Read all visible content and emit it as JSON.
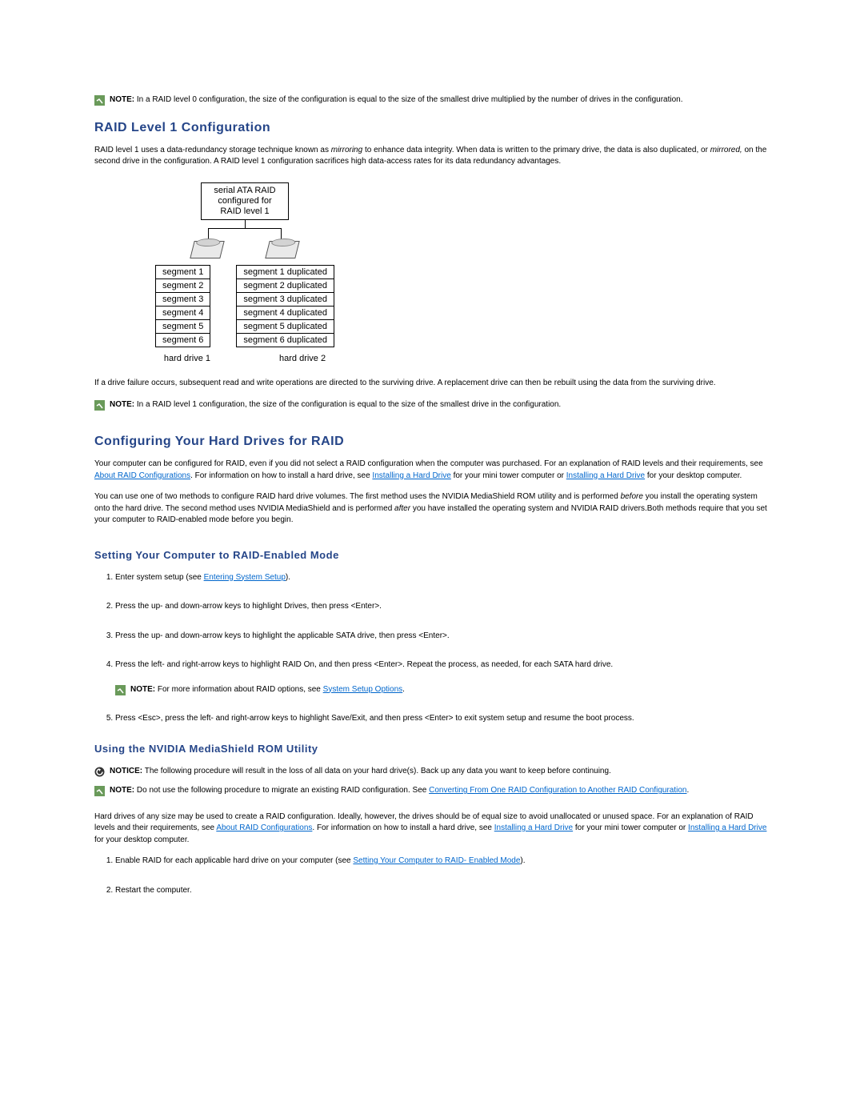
{
  "top_note": {
    "label": "NOTE:",
    "text": " In a RAID level 0 configuration, the size of the configuration is equal to the size of the smallest drive multiplied by the number of drives in the configuration."
  },
  "raid1": {
    "heading": "RAID Level 1 Configuration",
    "paragraph_before_italic1": "RAID level 1 uses a data-redundancy storage technique known as ",
    "italic1": "mirroring",
    "paragraph_mid": " to enhance data integrity. When data is written to the primary drive, the data is also duplicated, or ",
    "italic2": "mirrored,",
    "paragraph_after": " on the second drive in the configuration. A RAID level 1 configuration sacrifices high data-access rates for its data redundancy advantages.",
    "diagram": {
      "title_line1": "serial ATA RAID",
      "title_line2": "configured for",
      "title_line3": "RAID level 1",
      "left_segments": [
        "segment 1",
        "segment 2",
        "segment 3",
        "segment 4",
        "segment 5",
        "segment 6"
      ],
      "right_segments": [
        "segment 1 duplicated",
        "segment 2 duplicated",
        "segment 3 duplicated",
        "segment 4 duplicated",
        "segment 5 duplicated",
        "segment 6 duplicated"
      ],
      "foot_left": "hard drive 1",
      "foot_right": "hard drive 2"
    },
    "post_diagram": "If a drive failure occurs, subsequent read and write operations are directed to the surviving drive. A replacement drive can then be rebuilt using the data from the surviving drive.",
    "note_label": "NOTE:",
    "note_text": " In a RAID level 1 configuration, the size of the configuration is equal to the size of the smallest drive in the configuration."
  },
  "configuring": {
    "heading": "Configuring Your Hard Drives for RAID",
    "para": {
      "t1": "Your computer can be configured for RAID, even if you did not select a RAID configuration when the computer was purchased. For an explanation of RAID levels and their requirements, see ",
      "link1": "About RAID Configurations",
      "t2": ". For information on how to install a hard drive, see ",
      "link2": "Installing a Hard Drive",
      "t3": " for your mini tower computer or ",
      "link3": "Installing a Hard Drive",
      "t4": " for your desktop computer."
    },
    "para2": {
      "t1": "You can use one of two methods to configure RAID hard drive volumes. The first method uses the NVIDIA MediaShield ROM utility and is performed ",
      "i1": "before",
      "t2": " you install the operating system onto the hard drive. The second method uses NVIDIA MediaShield and is performed ",
      "i2": "after",
      "t3": " you have installed the operating system and NVIDIA RAID drivers.Both methods require that you set your computer to RAID-enabled mode before you begin."
    }
  },
  "setting": {
    "heading": "Setting Your Computer to RAID-Enabled Mode",
    "step1_t1": "Enter system setup (see ",
    "step1_link": "Entering System Setup",
    "step1_t2": ").",
    "step2": "Press the up- and down-arrow keys to highlight Drives, then press <Enter>.",
    "step3": "Press the up- and down-arrow keys to highlight the applicable SATA drive, then press <Enter>.",
    "step4": "Press the left- and right-arrow keys to highlight RAID On, and then press <Enter>. Repeat the process, as needed, for each SATA hard drive.",
    "step4_note_label": "NOTE:",
    "step4_note_t1": " For more information about RAID options, see ",
    "step4_note_link": "System Setup Options",
    "step4_note_t2": ".",
    "step5": "Press <Esc>, press the left- and right-arrow keys to highlight Save/Exit, and then press <Enter> to exit system setup and resume the boot process."
  },
  "mediashield": {
    "heading": "Using the NVIDIA MediaShield ROM Utility",
    "notice_label": "NOTICE:",
    "notice_text": " The following procedure will result in the loss of all data on your hard drive(s). Back up any data you want to keep before continuing.",
    "note_label": "NOTE:",
    "note_t1": " Do not use the following procedure to migrate an existing RAID configuration. See ",
    "note_link": "Converting From One RAID Configuration to Another RAID Configuration",
    "note_t2": ".",
    "para": {
      "t1": "Hard drives of any size may be used to create a RAID configuration. Ideally, however, the drives should be of equal size to avoid unallocated or unused space. For an explanation of RAID levels and their requirements, see ",
      "link1": "About RAID Configurations",
      "t2": ". For information on how to install a hard drive, see ",
      "link2": "Installing a Hard Drive",
      "t3": " for your mini tower computer or ",
      "link3": "Installing a Hard Drive",
      "t4": " for your desktop computer."
    },
    "step1_t1": "Enable RAID for each applicable hard drive on your computer (see ",
    "step1_link": "Setting Your Computer to RAID- Enabled Mode",
    "step1_t2": ").",
    "step2": "Restart the computer."
  }
}
